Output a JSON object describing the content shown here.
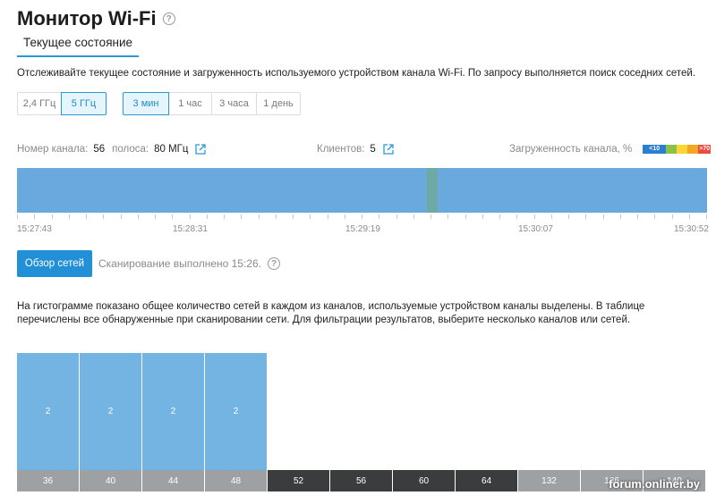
{
  "header": {
    "title": "Монитор Wi-Fi"
  },
  "tabs": [
    {
      "label": "Текущее состояние",
      "active": true
    }
  ],
  "description": "Отслеживайте текущее состояние и загруженность используемого устройством канала Wi-Fi. По запросу выполняется поиск соседних сетей.",
  "band_options": [
    {
      "label": "2,4 ГГц",
      "active": false
    },
    {
      "label": "5 ГГц",
      "active": true
    }
  ],
  "period_options": [
    {
      "label": "3 мин",
      "active": true
    },
    {
      "label": "1 час",
      "active": false
    },
    {
      "label": "3 часа",
      "active": false
    },
    {
      "label": "1 день",
      "active": false
    }
  ],
  "channel_info": {
    "channel_label": "Номер канала:",
    "channel_value": "56",
    "width_label": "полоса:",
    "width_value": "80 МГц",
    "clients_label": "Клиентов:",
    "clients_value": "5",
    "load_label": "Загруженность канала, %",
    "load_legend": [
      {
        "text": "<10",
        "color": "#2a7fd0"
      },
      {
        "text": "",
        "color": "#8bc34a"
      },
      {
        "text": "",
        "color": "#ffd633"
      },
      {
        "text": "",
        "color": "#f5a623"
      },
      {
        "text": ">70",
        "color": "#e74c3c"
      }
    ]
  },
  "timeline": {
    "times": [
      "15:27:43",
      "15:28:31",
      "15:29:19",
      "15:30:07",
      "15:30:52"
    ]
  },
  "scan": {
    "button_label": "Обзор сетей",
    "status": "Сканирование выполнено 15:26."
  },
  "histogram_text": "На гистограмме показано общее количество сетей в каждом из каналов, используемые устройством каналы выделены. В таблице перечислены все обнаруженные при сканировании сети. Для фильтрации результатов, выберите несколько каналов или сетей.",
  "chart_data": {
    "type": "bar",
    "categories": [
      "36",
      "40",
      "44",
      "48",
      "52",
      "56",
      "60",
      "64",
      "132",
      "136",
      "140"
    ],
    "values": [
      2,
      2,
      2,
      2,
      0,
      0,
      0,
      0,
      0,
      0,
      0
    ],
    "used_channels": [
      "52",
      "56",
      "60",
      "64"
    ]
  },
  "watermark": "forum.onliner.by",
  "colors": {
    "accent": "#2190d7",
    "bar": "#74b4e2",
    "timeline": "#6aa9dd",
    "channel_default": "#9ea1a4",
    "channel_used": "#3b3c3d"
  }
}
